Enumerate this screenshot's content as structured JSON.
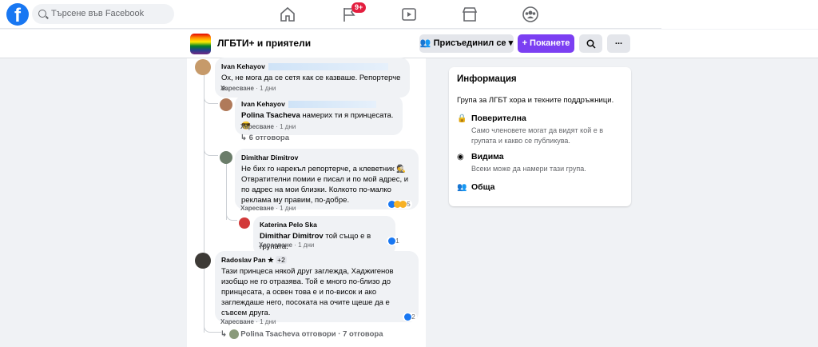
{
  "header": {
    "logo": "f",
    "search_placeholder": "Търсене във Facebook",
    "notifications_badge": "9+",
    "nav_icons": [
      "home-icon",
      "flag-icon",
      "video-icon",
      "marketplace-icon",
      "groups-icon"
    ]
  },
  "group": {
    "name": "ЛГБТИ+ и приятели",
    "joined_label": "Присъединил се",
    "invite_label": "+ Поканете",
    "more_label": "..."
  },
  "comments": [
    {
      "author": "Ivan Kehayov",
      "text": "Ох, не мога да се сетя как се казваше. Репортерче е.",
      "like": "Харесване",
      "time": "1 дни"
    },
    {
      "author": "Ivan Kehayov",
      "mention": "Polina Tsacheva",
      "text": " намерих ти я принцесата. 😎",
      "like": "Харесване",
      "time": "1 дни",
      "replies": "6 отговора"
    },
    {
      "author": "Dimithar Dimitrov",
      "text": "Не бих го нарекъл репортерче, а клеветник 🕵 Отвратителни помии е писал и по мой адрес, и по адрес на мои близки. Колкото по-малко реклама му правим, по-добре.",
      "like": "Харесване",
      "time": "1 дни",
      "reactions": "5"
    },
    {
      "author": "Katerina Pelo Ska",
      "mention": "Dimithar Dimitrov",
      "text": " той също е в групата.",
      "like": "Харесване",
      "time": "1 дни",
      "reactions": "1"
    },
    {
      "author": "Radoslav Pan",
      "extra": "+2",
      "text": "Тази принцеса някой друг заглежда, Хаджигенов изобщо не го отразява. Той е много по-близо до принцесата, а освен това е и по-висок и ако заглеждаше него, посоката на очите щеше да е съвсем друга.",
      "like": "Харесване",
      "time": "1 дни",
      "reactions": "2",
      "reply_summary": "Polina Tsacheva отговори · 7 отговора"
    }
  ],
  "info": {
    "title": "Информация",
    "description": "Група за ЛГБТ хора и техните поддръжници.",
    "privacy_title": "Поверителна",
    "privacy_desc": "Само членовете могат да видят кой е в групата и какво се публикува.",
    "visibility_title": "Видима",
    "visibility_desc": "Всеки може да намери тази група.",
    "general_title": "Обща"
  },
  "colors": {
    "brand": "#1877f2",
    "invite": "#7b3ff2",
    "badge": "#e41e3f"
  }
}
